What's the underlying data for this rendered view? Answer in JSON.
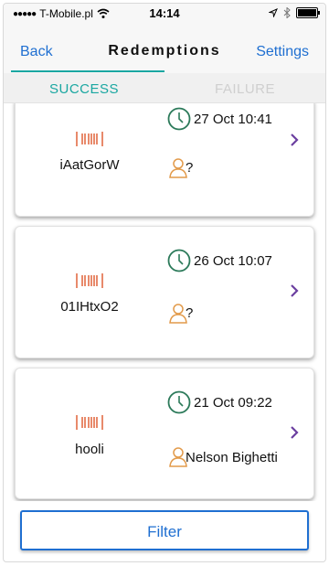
{
  "status_bar": {
    "carrier": "T-Mobile.pl",
    "time": "14:14"
  },
  "nav": {
    "back_label": "Back",
    "title": "Redemptions",
    "settings_label": "Settings"
  },
  "tabs": [
    {
      "label": "SUCCESS",
      "active": true
    },
    {
      "label": "FAILURE",
      "active": false
    }
  ],
  "redemptions": [
    {
      "code": "iAatGorW",
      "date": "27 Oct 10:41",
      "user": "?"
    },
    {
      "code": "01IHtxO2",
      "date": "26 Oct 10:07",
      "user": "?"
    },
    {
      "code": "hooli",
      "date": "21 Oct 09:22",
      "user": "Nelson Bighetti"
    }
  ],
  "filter_label": "Filter",
  "colors": {
    "accent_blue": "#1f6fd1",
    "tab_teal": "#1aa7a1",
    "barcode_orange": "#e0643a",
    "clock_green": "#2c7a5a",
    "person_orange": "#e29a4a",
    "chevron_purple": "#6b3fa0"
  },
  "icons": {
    "barcode": "barcode-icon",
    "clock": "clock-icon",
    "person": "person-icon",
    "chevron": "chevron-right-icon"
  }
}
